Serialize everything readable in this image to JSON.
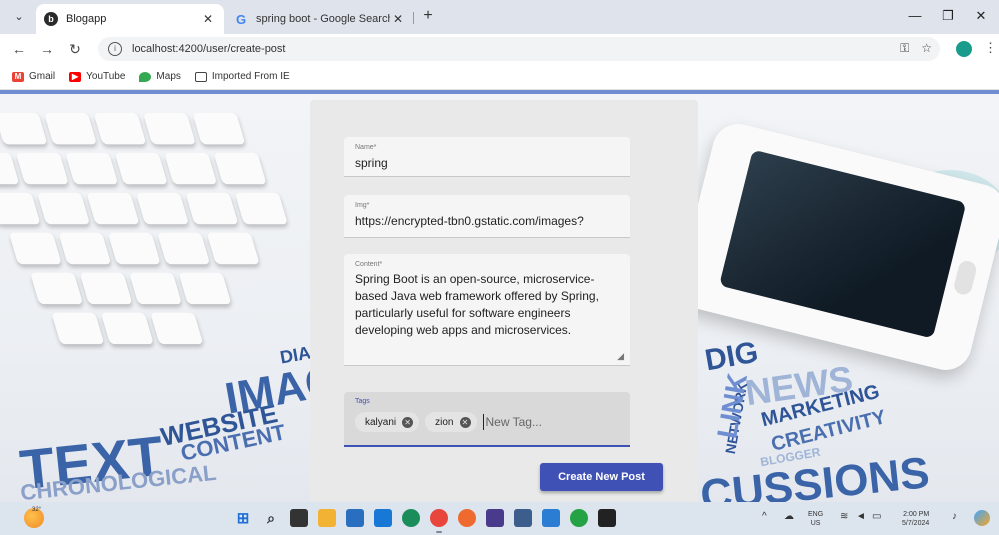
{
  "browser": {
    "tabs": [
      {
        "title": "Blogapp",
        "active": true
      },
      {
        "title": "spring boot - Google Search",
        "active": false
      }
    ],
    "address": "localhost:4200/user/create-post",
    "bookmarks": [
      "Gmail",
      "YouTube",
      "Maps",
      "Imported From IE"
    ]
  },
  "background_words": {
    "text": "TEXT",
    "website": "WEBSITE",
    "content": "CONTENT",
    "images": "IMAG",
    "chronological": "CHRONOLOGICAL",
    "news": "NEWS",
    "media": "DIA",
    "marketing": "MARKETING",
    "creativity": "CREATIVITY",
    "network": "NETWORK",
    "discussions": "CUSSIONS",
    "blogger": "BLOGGER",
    "dig": "DIG",
    "links": "LINK"
  },
  "form": {
    "name": {
      "label": "Name*",
      "value": "spring"
    },
    "img": {
      "label": "Img*",
      "value": "https://encrypted-tbn0.gstatic.com/images?"
    },
    "content": {
      "label": "Content*",
      "value": "Spring Boot is an open-source, microservice-based Java web framework offered by Spring, particularly useful for software engineers developing web apps and microservices."
    },
    "tags": {
      "label": "Tags",
      "chips": [
        "kalyani",
        "zion"
      ],
      "placeholder": "New Tag..."
    },
    "submit_label": "Create New Post"
  },
  "taskbar": {
    "weather_temp": "32°",
    "lang_line1": "ENG",
    "lang_line2": "US",
    "time": "2:00 PM",
    "date": "5/7/2024"
  },
  "colors": {
    "primary": "#3f51b5",
    "card": "#e9e9e9",
    "field": "#f5f5f5",
    "word_cloud": "#2f5597"
  }
}
